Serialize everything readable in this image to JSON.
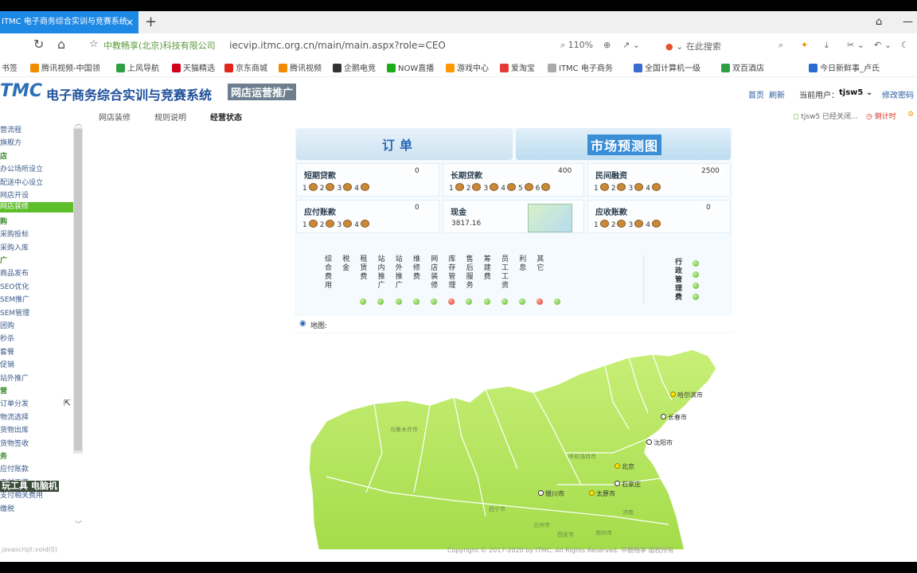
{
  "browser": {
    "tab_title": "ITMC 电子商务综合实训与竞赛系统",
    "tab_close": "×",
    "new_tab": "+",
    "url_domain": "中教畅享(北京)科技有限公司",
    "url_path": "iecvip.itmc.org.cn/main/main.aspx?role=CEO",
    "zoom": "110%",
    "search_hint": "在此搜索"
  },
  "bookmarks": [
    {
      "label": "书签",
      "color": "#888"
    },
    {
      "label": "腾讯视频-中国领",
      "color": "#f08a00"
    },
    {
      "label": "上风导航",
      "color": "#2ea043"
    },
    {
      "label": "天猫精选",
      "color": "#d0021b"
    },
    {
      "label": "京东商城",
      "color": "#e1251b"
    },
    {
      "label": "腾讯视频",
      "color": "#f08a00"
    },
    {
      "label": "企鹅电竞",
      "color": "#333"
    },
    {
      "label": "NOW直播",
      "color": "#1aad19"
    },
    {
      "label": "游戏中心",
      "color": "#ff9800"
    },
    {
      "label": "爱淘宝",
      "color": "#e53935"
    },
    {
      "label": "ITMC 电子商务",
      "color": "#aaa"
    },
    {
      "label": "全国计算机一级",
      "color": "#3a6bd0"
    },
    {
      "label": "双百酒店",
      "color": "#2ea043"
    },
    {
      "label": "今日新鲜事_卢氏",
      "color": "#2a6bd0"
    }
  ],
  "header": {
    "logo": "TMC",
    "title": "电子商务综合实训与竞赛系统",
    "badge": "网店运营推广",
    "home": "首页",
    "refresh": "刷新",
    "current_user_label": "当前用户：",
    "current_user": "tjsw5",
    "change_password": "修改密码"
  },
  "subtabs": [
    "网店装修",
    "规则说明",
    "经营状态"
  ],
  "status_line": {
    "msg": "tjsw5 已经关闭...",
    "timer": "倒计时"
  },
  "sidebar": [
    {
      "label": "营流程",
      "type": "item"
    },
    {
      "label": "旗舰方",
      "type": "item"
    },
    {
      "label": "店",
      "type": "group"
    },
    {
      "label": "办公场所设立",
      "type": "item"
    },
    {
      "label": "配送中心设立",
      "type": "item"
    },
    {
      "label": "网店开设",
      "type": "item"
    },
    {
      "label": "网店装修",
      "type": "active"
    },
    {
      "label": "购",
      "type": "group"
    },
    {
      "label": "采购投标",
      "type": "item"
    },
    {
      "label": "采购入库",
      "type": "item"
    },
    {
      "label": "广",
      "type": "group"
    },
    {
      "label": "商品发布",
      "type": "item"
    },
    {
      "label": "SEO优化",
      "type": "item"
    },
    {
      "label": "SEM推广",
      "type": "item"
    },
    {
      "label": "SEM管理",
      "type": "item"
    },
    {
      "label": "团购",
      "type": "item"
    },
    {
      "label": "秒杀",
      "type": "item"
    },
    {
      "label": "套餐",
      "type": "item"
    },
    {
      "label": "促销",
      "type": "item"
    },
    {
      "label": "站外推广",
      "type": "item"
    },
    {
      "label": "营",
      "type": "group"
    },
    {
      "label": "订单分发",
      "type": "item"
    },
    {
      "label": "物流选择",
      "type": "item"
    },
    {
      "label": "货物出库",
      "type": "item"
    },
    {
      "label": "货物签收",
      "type": "item"
    },
    {
      "label": "务",
      "type": "group"
    },
    {
      "label": "应付账款",
      "type": "item"
    },
    {
      "label": "支付工资",
      "type": "item"
    },
    {
      "label": "支付相关费用",
      "type": "item"
    },
    {
      "label": "缴税",
      "type": "item"
    }
  ],
  "panel": {
    "order_tile": "订单",
    "market_tile": "市场预测图",
    "short_loan": {
      "label": "短期贷款",
      "value": "0",
      "slots": [
        "1",
        "2",
        "3",
        "4"
      ]
    },
    "long_loan": {
      "label": "长期贷款",
      "value": "400",
      "slots": [
        "1",
        "2",
        "3",
        "4",
        "5",
        "6"
      ]
    },
    "private_loan": {
      "label": "民间融资",
      "value": "2500",
      "slots": [
        "1",
        "2",
        "3",
        "4"
      ]
    },
    "payable": {
      "label": "应付账款",
      "value": "0",
      "slots": [
        "1",
        "2",
        "3",
        "4"
      ]
    },
    "cash": {
      "label": "现金",
      "value": "3817.16"
    },
    "receivable": {
      "label": "应收账款",
      "value": "0",
      "slots": [
        "1",
        "2",
        "3",
        "4"
      ]
    },
    "expenses": [
      {
        "label": "综合费用",
        "status": "none"
      },
      {
        "label": "税金",
        "status": "green"
      },
      {
        "label": "租赁费",
        "status": "green"
      },
      {
        "label": "站内推广",
        "status": "green"
      },
      {
        "label": "站外推广",
        "status": "green"
      },
      {
        "label": "维修费",
        "status": "green"
      },
      {
        "label": "网店装修",
        "status": "red"
      },
      {
        "label": "库存管理",
        "status": "green"
      },
      {
        "label": "售后服务",
        "status": "green"
      },
      {
        "label": "筹建费",
        "status": "green"
      },
      {
        "label": "员工工资",
        "status": "green"
      },
      {
        "label": "利息",
        "status": "red"
      },
      {
        "label": "其它",
        "status": "green"
      }
    ],
    "admin_fee": "行政管理费",
    "admin_dots": 4,
    "map_label": "地图:"
  },
  "map": {
    "cities": [
      {
        "label": "哈尔滨市",
        "capital": true
      },
      {
        "label": "长春市",
        "capital": false
      },
      {
        "label": "沈阳市",
        "capital": false
      },
      {
        "label": "北京",
        "capital": true
      },
      {
        "label": "石家庄",
        "capital": false
      },
      {
        "label": "太原市",
        "capital": true
      },
      {
        "label": "银川市",
        "capital": false
      }
    ],
    "provinces": [
      "乌鲁木齐市",
      "呼和浩特市",
      "西宁市",
      "兰州市",
      "西安市",
      "郑州市",
      "济南"
    ]
  },
  "footer": {
    "copyright": "Copyright © 2017-2020 by ITMC. All Rights Reserved. 中教畅享 版权所有",
    "status": "javascript:void(0)",
    "watermark": "玩工具 电脑机"
  }
}
